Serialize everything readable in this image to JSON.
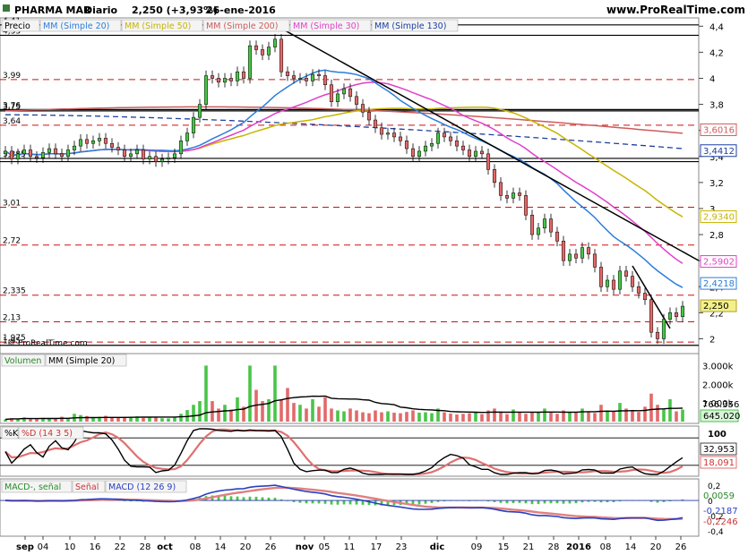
{
  "header": {
    "symbol": "PHARMA MAR",
    "interval": "Diario",
    "price_change": "2,250 (+3,93%)",
    "date": "26-ene-2016",
    "site": "www.ProRealTime.com",
    "watermark": "© ProRealTime.com"
  },
  "legends": {
    "price": [
      "Precio",
      "MM (Simple 20)",
      "MM (Simple 50)",
      "MM (Simple 200)",
      "MM (Simple 30)",
      "MM (Simple 130)"
    ],
    "volume": [
      "Volumen",
      "MM (Simple 20)"
    ],
    "stoch": [
      "%K",
      "%D (14 3 5)"
    ],
    "macd": [
      "MACD-, señal",
      "Señal",
      "MACD (12 26 9)"
    ]
  },
  "colors": {
    "up": "#49c549",
    "down": "#e26a6a",
    "mm20": "#2a7ddb",
    "mm50": "#c8b400",
    "mm200": "#cd5c5c",
    "mm30": "#e040c8",
    "mm130": "#1c3fa0",
    "trend": "#000000",
    "hline": "#d01010"
  },
  "price_axis_ticks": [
    "4,4",
    "4,2",
    "4",
    "3,8",
    "3,6",
    "3,4",
    "3,2",
    "3",
    "2,8",
    "2,6",
    "2,4",
    "2,2",
    "2"
  ],
  "price_level_labels": [
    "4,41",
    "4,33",
    "3,99",
    "3,76",
    "3,75",
    "3,64",
    "3,385",
    "3,01",
    "2,72",
    "2,335",
    "2,13",
    "1,975",
    "1,95"
  ],
  "right_value_labels": [
    "3,6016",
    "3,4412",
    "2,9340",
    "2,5902",
    "2,4218",
    "2,250"
  ],
  "volume_axis": [
    "3.000k",
    "2.000k",
    "1.000k"
  ],
  "volume_values": [
    "766.356",
    "645.020"
  ],
  "stoch_axis": [
    "100"
  ],
  "stoch_values": [
    "32,953",
    "18,091"
  ],
  "macd_axis": [
    "0,2",
    "0",
    "-0,2",
    "-0,4"
  ],
  "macd_values": [
    "0,0059",
    "-0,2187",
    "-0,2246"
  ],
  "x_axis": [
    "sep",
    "04",
    "10",
    "16",
    "22",
    "28",
    "oct",
    "08",
    "14",
    "20",
    "26",
    "nov",
    "05",
    "11",
    "17",
    "23",
    "dic",
    "09",
    "15",
    "21",
    "28",
    "2016",
    "08",
    "14",
    "20",
    "26"
  ],
  "chart_data": [
    {
      "type": "candlestick",
      "title": "PHARMA MAR",
      "ylim": [
        1.9,
        4.45
      ],
      "y_ticks": [
        2,
        2.2,
        2.4,
        2.6,
        2.8,
        3,
        3.2,
        3.4,
        3.6,
        3.8,
        4,
        4.2,
        4.4
      ],
      "solid_levels": [
        4.41,
        4.33,
        3.76,
        3.75,
        3.385,
        3.36,
        1.95
      ],
      "dashed_levels": [
        3.99,
        3.64,
        3.01,
        2.72,
        2.335,
        2.13,
        1.975
      ],
      "series": [
        {
          "name": "Precio",
          "close": [
            3.44,
            3.38,
            3.42,
            3.45,
            3.4,
            3.39,
            3.43,
            3.46,
            3.42,
            3.4,
            3.45,
            3.48,
            3.53,
            3.5,
            3.52,
            3.54,
            3.5,
            3.47,
            3.45,
            3.4,
            3.42,
            3.45,
            3.38,
            3.4,
            3.36,
            3.38,
            3.39,
            3.42,
            3.52,
            3.58,
            3.7,
            3.8,
            4.02,
            4.0,
            3.97,
            4.0,
            3.98,
            4.05,
            4.0,
            4.25,
            4.22,
            4.18,
            4.24,
            4.3,
            4.05,
            4.02,
            4.0,
            4.0,
            3.98,
            4.03,
            4.02,
            3.95,
            3.82,
            3.88,
            3.92,
            3.86,
            3.8,
            3.74,
            3.68,
            3.62,
            3.57,
            3.58,
            3.55,
            3.52,
            3.46,
            3.4,
            3.44,
            3.48,
            3.5,
            3.58,
            3.55,
            3.52,
            3.48,
            3.45,
            3.4,
            3.44,
            3.42,
            3.3,
            3.2,
            3.1,
            3.08,
            3.12,
            3.1,
            2.95,
            2.8,
            2.85,
            2.92,
            2.82,
            2.75,
            2.6,
            2.65,
            2.62,
            2.7,
            2.65,
            2.55,
            2.4,
            2.45,
            2.38,
            2.52,
            2.48,
            2.4,
            2.35,
            2.3,
            2.05,
            2.0,
            2.15,
            2.2,
            2.17,
            2.25
          ]
        },
        {
          "name": "MM (Simple 20)",
          "last": 2.4218
        },
        {
          "name": "MM (Simple 50)",
          "last": 2.934
        },
        {
          "name": "MM (Simple 200)",
          "last": 3.6016
        },
        {
          "name": "MM (Simple 30)",
          "last": 2.5902
        },
        {
          "name": "MM (Simple 130)",
          "last": 3.4412
        }
      ]
    },
    {
      "type": "bar",
      "title": "Volumen",
      "ylim": [
        0,
        3500
      ],
      "units": "k",
      "series": [
        {
          "name": "Volumen",
          "values": [
            120,
            180,
            150,
            220,
            140,
            160,
            200,
            190,
            170,
            260,
            180,
            420,
            350,
            300,
            220,
            260,
            310,
            240,
            200,
            260,
            230,
            280,
            190,
            210,
            240,
            180,
            170,
            220,
            420,
            620,
            900,
            1100,
            3000,
            1100,
            700,
            900,
            650,
            1300,
            800,
            3000,
            1700,
            1100,
            1200,
            3000,
            1200,
            1800,
            1000,
            900,
            700,
            1200,
            800,
            1300,
            700,
            600,
            550,
            700,
            600,
            500,
            450,
            600,
            500,
            550,
            480,
            450,
            520,
            600,
            480,
            500,
            450,
            700,
            500,
            430,
            380,
            420,
            450,
            520,
            400,
            600,
            700,
            550,
            400,
            650,
            480,
            420,
            520,
            480,
            700,
            500,
            420,
            600,
            480,
            500,
            700,
            550,
            460,
            900,
            600,
            550,
            1000,
            700,
            600,
            520,
            800,
            1500,
            900,
            700,
            1200,
            550,
            645
          ]
        },
        {
          "name": "MM (Simple 20)",
          "last": 766.356
        }
      ]
    },
    {
      "type": "line",
      "title": "%K",
      "ylim": [
        0,
        100
      ],
      "series": [
        {
          "name": "%K",
          "last": 32.953
        },
        {
          "name": "%D (14 3 5)",
          "last": 18.091
        }
      ]
    },
    {
      "type": "line",
      "title": "MACD (12 26 9)",
      "ylim": [
        -0.45,
        0.25
      ],
      "series": [
        {
          "name": "MACD-, señal",
          "last": 0.0059
        },
        {
          "name": "Señal",
          "last": -0.2246
        },
        {
          "name": "MACD (12 26 9)",
          "last": -0.2187
        }
      ]
    }
  ]
}
